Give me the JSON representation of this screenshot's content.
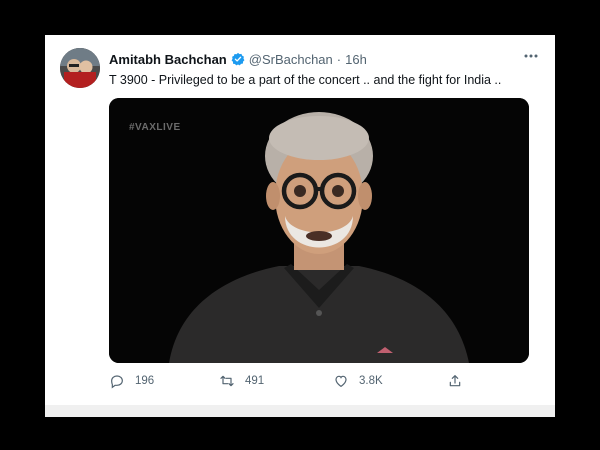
{
  "tweet": {
    "author_name": "Amitabh Bachchan",
    "author_handle": "@SrBachchan",
    "separator": "·",
    "time": "16h",
    "text": "T 3900 - Privileged to be a part of the concert .. and the fight for India ..",
    "verified": true,
    "media": {
      "watermark": "#VAXLIVE"
    },
    "actions": {
      "reply_count": "196",
      "retweet_count": "491",
      "like_count": "3.8K"
    }
  },
  "colors": {
    "accent": "#1d9bf0",
    "text_primary": "#0f1419",
    "text_secondary": "#536471"
  }
}
